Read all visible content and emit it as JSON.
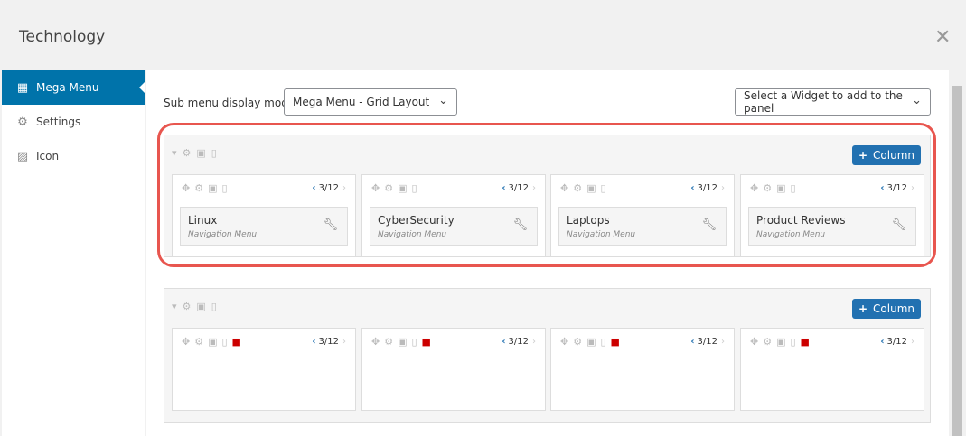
{
  "title": "Technology",
  "sidebar": {
    "items": [
      {
        "label": "Mega Menu",
        "icon": "grid-icon"
      },
      {
        "label": "Settings",
        "icon": "gear-icon"
      },
      {
        "label": "Icon",
        "icon": "image-icon"
      }
    ]
  },
  "main": {
    "mode_label": "Sub menu display mode",
    "mode_value": "Mega Menu - Grid Layout",
    "widget_select": "Select a Widget to add to the panel",
    "add_column": "Column",
    "rows": [
      {
        "columns": [
          {
            "width": "3/12",
            "widget": {
              "title": "Linux",
              "type": "Navigation Menu"
            }
          },
          {
            "width": "3/12",
            "widget": {
              "title": "CyberSecurity",
              "type": "Navigation Menu"
            }
          },
          {
            "width": "3/12",
            "widget": {
              "title": "Laptops",
              "type": "Navigation Menu"
            }
          },
          {
            "width": "3/12",
            "widget": {
              "title": "Product Reviews",
              "type": "Navigation Menu"
            }
          }
        ]
      },
      {
        "columns": [
          {
            "width": "3/12"
          },
          {
            "width": "3/12"
          },
          {
            "width": "3/12"
          },
          {
            "width": "3/12"
          }
        ]
      }
    ]
  },
  "colors": {
    "accent": "#0073aa",
    "button": "#2271b1",
    "highlight": "#e8564f",
    "trash": "#cc0000"
  }
}
